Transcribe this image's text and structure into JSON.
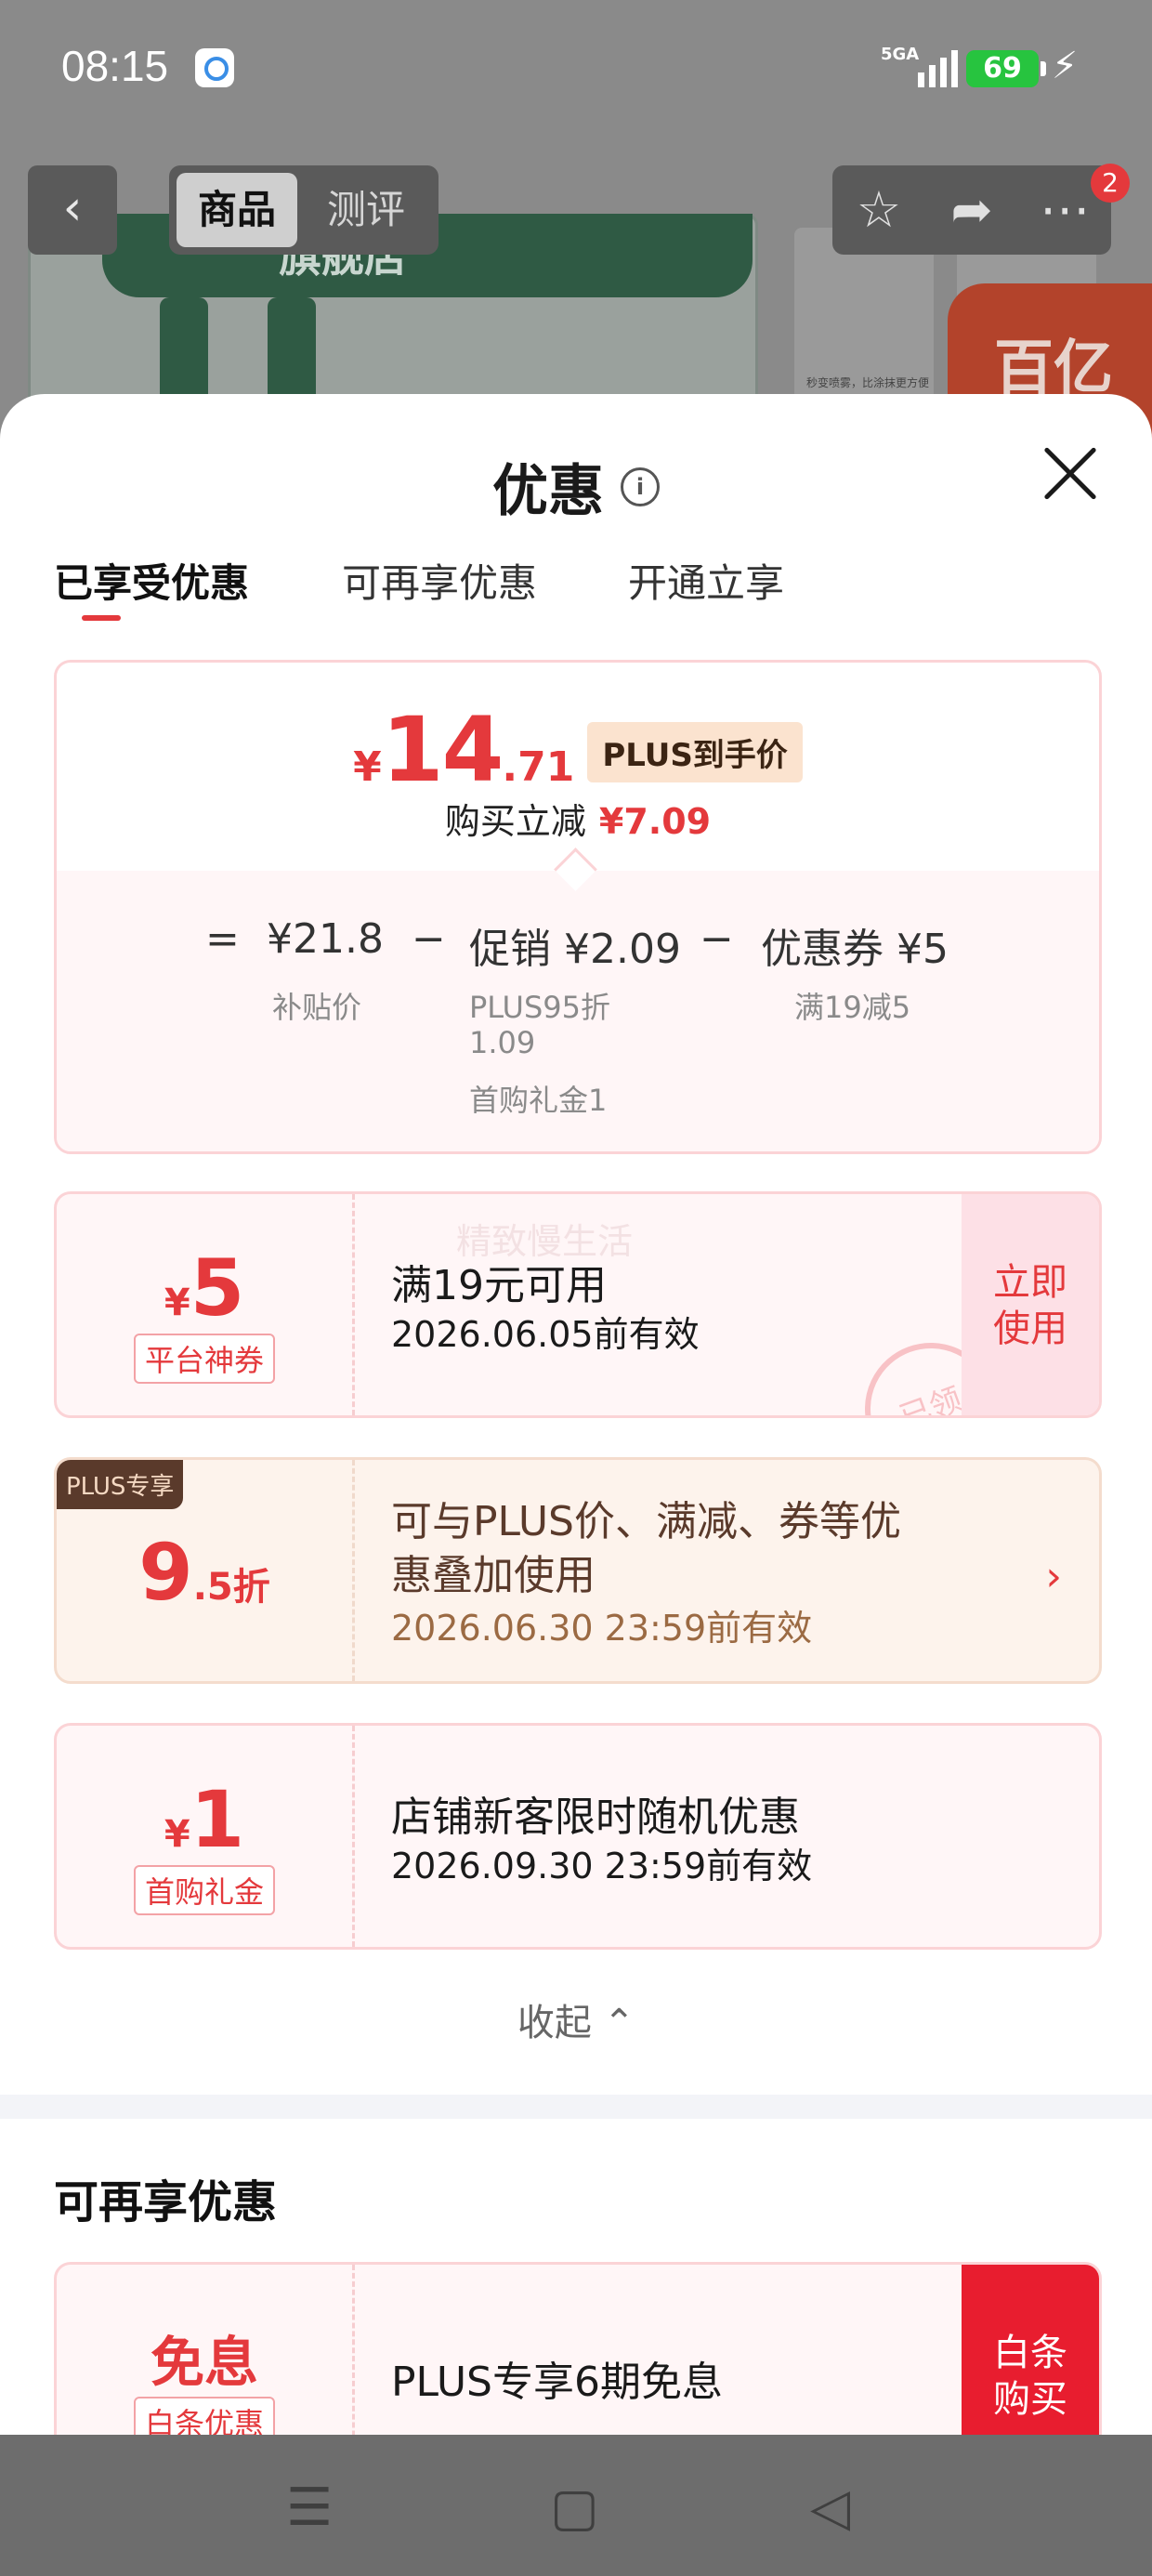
{
  "status_bar": {
    "time": "08:15",
    "network": "5GA",
    "battery": "69"
  },
  "background": {
    "nav_tabs": [
      "商品",
      "测评"
    ],
    "brand_text": "旗舰店",
    "thumb_caption": "秒变喷雾，比涂抹更方便",
    "badge_text": "百亿",
    "cart_count": "2"
  },
  "sheet": {
    "title": "优惠",
    "tabs": [
      "已享受优惠",
      "可再享优惠",
      "开通立享"
    ],
    "summary": {
      "currency": "¥",
      "price_int": "14",
      "price_dec": ".71",
      "plus_tag": "PLUS到手价",
      "reduce_label": "购买立减",
      "reduce_amount": "¥7.09",
      "eq": "=",
      "minus": "−",
      "base_price": "¥21.8",
      "base_label": "补贴价",
      "promo": "促销 ¥2.09",
      "promo_line1": "PLUS95折",
      "promo_line2": "1.09",
      "promo_line3": "首购礼金1",
      "coupon": "优惠券 ¥5",
      "coupon_label": "满19减5"
    },
    "coupons": [
      {
        "symbol": "¥",
        "value": "5",
        "tag": "平台神券",
        "title": "满19元可用",
        "validity": "2026.06.05前有效",
        "action": [
          "立即",
          "使用"
        ],
        "stamp": "已领",
        "watermark": "精致慢生活"
      },
      {
        "badge": "PLUS专享",
        "value": "9",
        "suffix": ".5折",
        "title_line1": "可与PLUS价、满减、券等优",
        "title_line2": "惠叠加使用",
        "validity": "2026.06.30 23:59前有效",
        "arrow": "›"
      },
      {
        "symbol": "¥",
        "value": "1",
        "tag": "首购礼金",
        "title": "店铺新客限时随机优惠",
        "validity": "2026.09.30 23:59前有效"
      }
    ],
    "collapse_label": "收起",
    "more_section": {
      "title": "可再享优惠",
      "value": "免息",
      "tag": "白条优惠",
      "title_text": "PLUS专享6期免息",
      "action": [
        "白条",
        "购买"
      ]
    }
  },
  "colors": {
    "accent": "#e4393c",
    "plus_brown": "#5a3a2b",
    "card_bg": "#fff6f7"
  }
}
